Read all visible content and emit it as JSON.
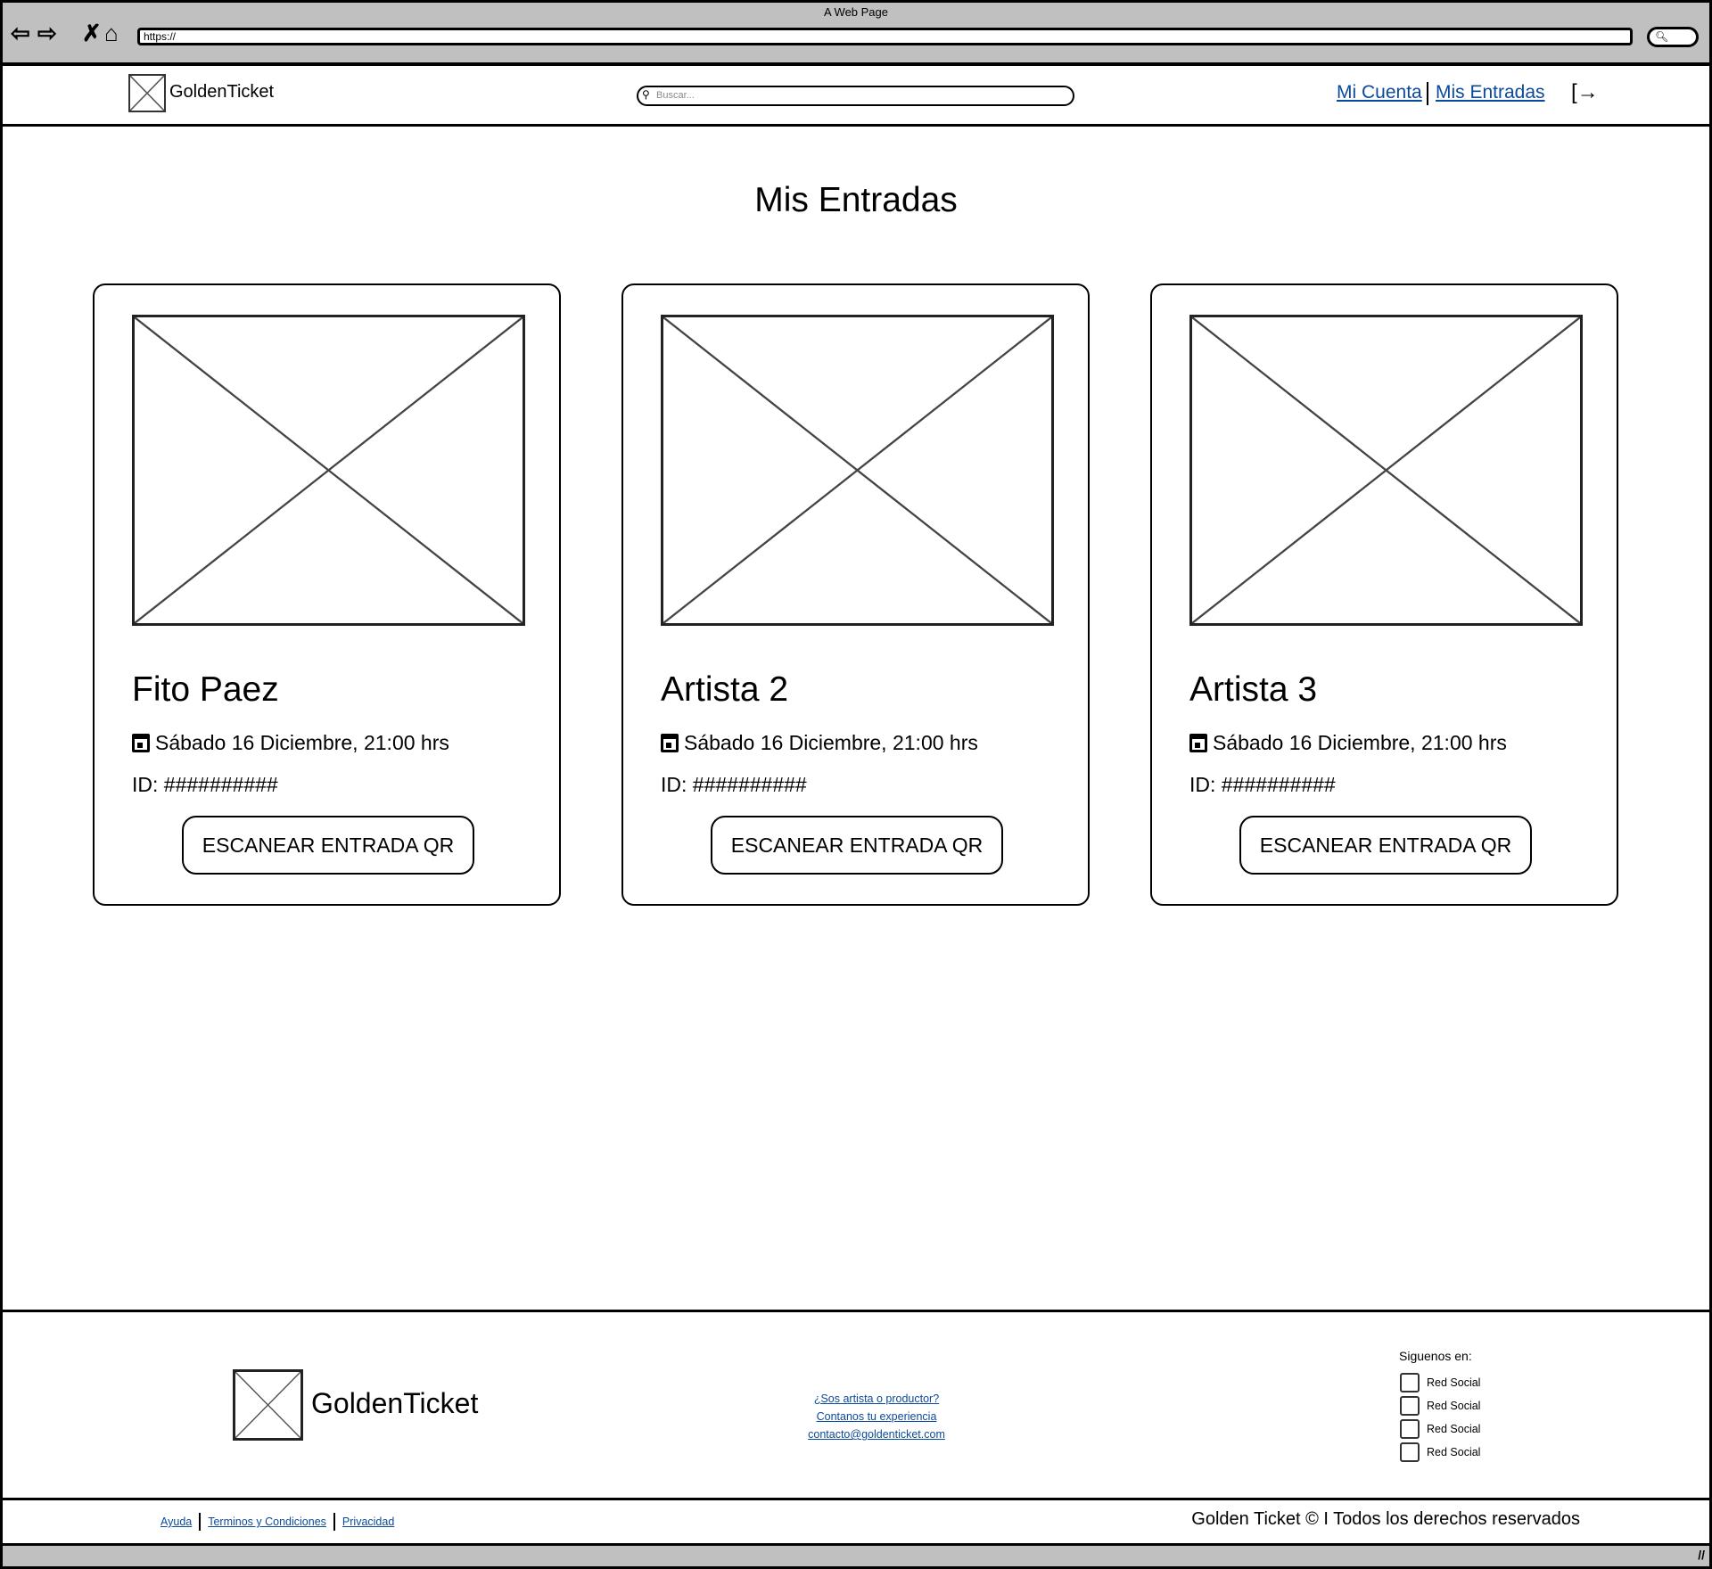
{
  "browser": {
    "title": "A Web Page",
    "url": "https://",
    "nav_icons": [
      "back-icon",
      "forward-icon",
      "close-icon",
      "home-icon"
    ]
  },
  "header": {
    "logo_text": "GoldenTicket",
    "search_placeholder": "Buscar...",
    "links": {
      "account": "Mi Cuenta",
      "tickets": "Mis Entradas"
    }
  },
  "main": {
    "title": "Mis Entradas",
    "cards": [
      {
        "name": "Fito Paez",
        "date": "Sábado 16 Diciembre, 21:00 hrs",
        "id": "ID: ##########",
        "button": "ESCANEAR ENTRADA QR"
      },
      {
        "name": "Artista 2",
        "date": "Sábado 16 Diciembre, 21:00 hrs",
        "id": "ID: ##########",
        "button": "ESCANEAR ENTRADA QR"
      },
      {
        "name": "Artista 3",
        "date": "Sábado 16 Diciembre, 21:00 hrs",
        "id": "ID: ##########",
        "button": "ESCANEAR ENTRADA QR"
      }
    ]
  },
  "footer": {
    "logo_text": "GoldenTicket",
    "links": [
      "¿Sos artista o productor?",
      "Contanos tu experiencia",
      "contacto@goldenticket.com"
    ],
    "follow_label": "Siguenos en:",
    "socials": [
      "Red Social",
      "Red Social",
      "Red Social",
      "Red Social"
    ],
    "bottom_links": [
      "Ayuda",
      "Terminos y Condiciones",
      "Privacidad"
    ],
    "copyright": "Golden Ticket © I Todos los derechos reservados"
  },
  "colors": {
    "link": "#0b4a9a",
    "chrome": "#c0c0c0"
  }
}
